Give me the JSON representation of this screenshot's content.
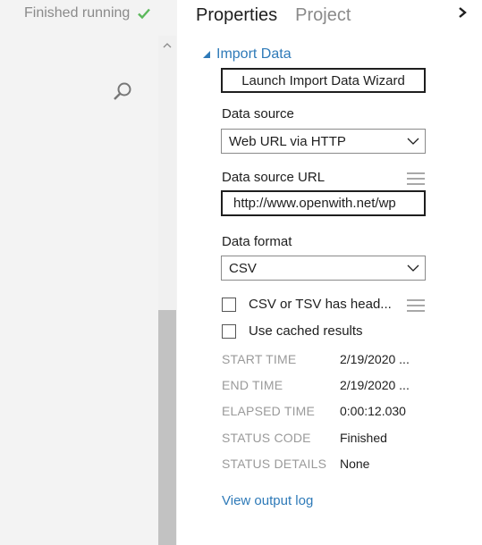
{
  "canvas": {
    "status_text": "Finished running"
  },
  "panel": {
    "tabs": [
      "Properties",
      "Project"
    ],
    "section_title": "Import Data",
    "wizard_button": "Launch Import Data Wizard",
    "data_source": {
      "label": "Data source",
      "value": "Web URL via HTTP"
    },
    "data_source_url": {
      "label": "Data source URL",
      "value": "http://www.openwith.net/wp"
    },
    "data_format": {
      "label": "Data format",
      "value": "CSV"
    },
    "checkboxes": [
      {
        "label": "CSV or TSV has head...",
        "checked": false
      },
      {
        "label": "Use cached results",
        "checked": false
      }
    ],
    "info": [
      {
        "key": "START TIME",
        "value": "2/19/2020 ..."
      },
      {
        "key": "END TIME",
        "value": "2/19/2020 ..."
      },
      {
        "key": "ELAPSED TIME",
        "value": "0:00:12.030"
      },
      {
        "key": "STATUS CODE",
        "value": "Finished"
      },
      {
        "key": "STATUS DETAILS",
        "value": "None"
      }
    ],
    "log_link": "View output log"
  },
  "colors": {
    "accent": "#2e7ab8",
    "success": "#5cb85c",
    "muted": "#8a8a8a"
  },
  "icons": [
    "check-icon",
    "search-icon",
    "chevron-up-icon",
    "chevron-right-icon",
    "triangle-down-icon",
    "chevron-down-icon",
    "menu-icon"
  ]
}
